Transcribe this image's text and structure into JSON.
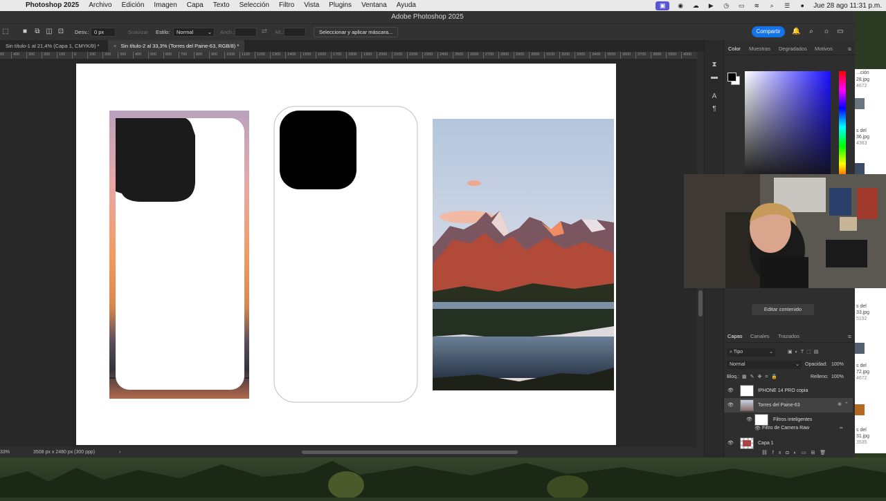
{
  "menubar": {
    "app": "Photoshop 2025",
    "items": [
      "Archivo",
      "Edición",
      "Imagen",
      "Capa",
      "Texto",
      "Selección",
      "Filtro",
      "Vista",
      "Plugins",
      "Ventana",
      "Ayuda"
    ],
    "clock": "Jue 28 ago 11:31 p.m."
  },
  "window": {
    "title": "Adobe Photoshop 2025"
  },
  "options": {
    "desv_label": "Desv.:",
    "desv_value": "0 px",
    "suavizar": "Suavizar",
    "estilo_label": "Estilo:",
    "estilo_value": "Normal",
    "anch": "Anch.:",
    "alt": "Alt.:",
    "mask_button": "Seleccionar y aplicar máscara...",
    "share": "Compartir"
  },
  "tabs": [
    {
      "label": "Sin título-1 al 21,4% (Capa 1, CMYK/8) *",
      "active": false
    },
    {
      "label": "Sin título-2 al 33,3% (Torres del Paine-63, RGB/8) *",
      "active": true
    }
  ],
  "ruler_ticks": [
    "500",
    "400",
    "300",
    "200",
    "100",
    "0",
    "100",
    "200",
    "300",
    "400",
    "500",
    "600",
    "700",
    "800",
    "900",
    "1000",
    "1100",
    "1200",
    "1300",
    "1400",
    "1500",
    "1600",
    "1700",
    "1800",
    "1900",
    "2000",
    "2100",
    "2200",
    "2300",
    "2400",
    "2500",
    "2600",
    "2700",
    "2800",
    "2900",
    "3000",
    "3100",
    "3200",
    "3300",
    "3400",
    "3500",
    "3600",
    "3700",
    "3800",
    "3900",
    "4000"
  ],
  "status": {
    "zoom": "33%",
    "doc_size": "3508 px x 2480 px (300 ppp)"
  },
  "color_panel": {
    "tabs": [
      "Color",
      "Muestras",
      "Degradados",
      "Motivos"
    ],
    "foreground": "#000000",
    "background": "#ffffff"
  },
  "edit_content_button": "Editar contenido",
  "layers_panel": {
    "tabs": [
      "Capas",
      "Canales",
      "Trazados"
    ],
    "filter_kind": "Tipo",
    "blend_mode": "Normal",
    "opacity_label": "Opacidad:",
    "opacity_value": "100%",
    "lock_label": "Bloq.:",
    "fill_label": "Relleno:",
    "fill_value": "100%",
    "layers": [
      {
        "name": "IPHONE 14 PRO copia",
        "selected": false
      },
      {
        "name": "Torres del Paine-63",
        "selected": true
      },
      {
        "name": "Filtros inteligentes",
        "selected": false
      },
      {
        "name": "Filtro de Camera Raw",
        "selected": false
      },
      {
        "name": "Capa 1",
        "selected": false
      }
    ]
  },
  "finder_files": [
    "...ción",
    "28.jpg",
    "4672",
    "s del",
    "36.jpg",
    "4383",
    "s del",
    "33.jpg",
    "5192",
    "s del",
    "72.jpg",
    "4672",
    "s del",
    "31.jpg",
    "3535"
  ]
}
